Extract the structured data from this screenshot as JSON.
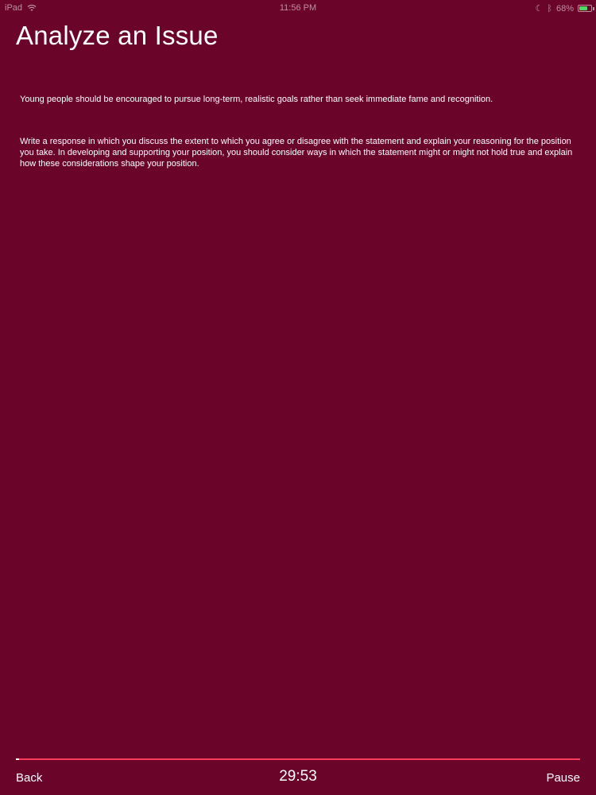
{
  "status_bar": {
    "carrier": "iPad",
    "time": "11:56 PM",
    "battery_percent": "68%",
    "battery_level": 0.68,
    "icons": [
      "wifi-icon",
      "bluetooth-icon",
      "moon-icon",
      "battery-icon"
    ]
  },
  "page": {
    "title": "Analyze an Issue",
    "prompt": "Young people should be encouraged to pursue long-term, realistic goals rather than seek immediate fame and recognition.",
    "instructions": "Write a response in which you discuss the extent to which you agree or disagree with the statement and explain your reasoning for the position you take. In developing and supporting your position, you should consider ways in which the statement might or might not hold true and explain how these considerations shape your position."
  },
  "footer": {
    "back_label": "Back",
    "timer": "29:53",
    "pause_label": "Pause",
    "progress": 0.006
  },
  "colors": {
    "background": "#6a0529",
    "progress_track": "#ff3b5c",
    "progress_fill": "#ffffff",
    "battery": "#4cd964"
  }
}
